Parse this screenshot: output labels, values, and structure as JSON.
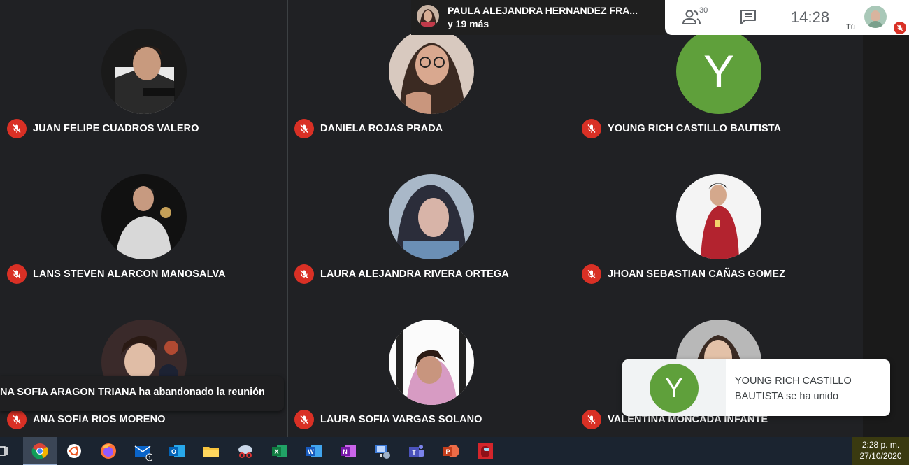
{
  "presenter": {
    "name": "PAULA ALEJANDRA HERNANDEZ FRA...",
    "more": "y 19 más"
  },
  "top_bar": {
    "participants_count": "30",
    "time": "14:28",
    "you_label": "Tú",
    "icons": [
      "people-icon",
      "chat-icon"
    ]
  },
  "participants": [
    {
      "name": "JUAN FELIPE CUADROS VALERO",
      "avatar": "photo"
    },
    {
      "name": "DANIELA ROJAS PRADA",
      "avatar": "photo"
    },
    {
      "name": "YOUNG RICH CASTILLO BAUTISTA",
      "avatar": "letter",
      "letter": "Y"
    },
    {
      "name": "LANS STEVEN ALARCON MANOSALVA",
      "avatar": "photo"
    },
    {
      "name": "LAURA ALEJANDRA RIVERA ORTEGA",
      "avatar": "photo"
    },
    {
      "name": "JHOAN SEBASTIAN CAÑAS GOMEZ",
      "avatar": "photo"
    },
    {
      "name": "ANA SOFIA RIOS MORENO",
      "avatar": "photo"
    },
    {
      "name": "LAURA SOFIA VARGAS SOLANO",
      "avatar": "photo"
    },
    {
      "name": "VALENTINA MONCADA INFANTE",
      "avatar": "photo"
    }
  ],
  "notifications": {
    "left_toast": "NA SOFIA ARAGON TRIANA ha abandonado la reunión",
    "right_toast": {
      "letter": "Y",
      "message": "YOUNG RICH CASTILLO BAUTISTA se ha unido"
    }
  },
  "taskbar": {
    "apps": [
      "task-view-icon",
      "chrome-icon",
      "ubuntu-icon",
      "firefox-icon",
      "mail-icon",
      "outlook-icon",
      "file-explorer-icon",
      "snipping-tool-icon",
      "excel-icon",
      "word-icon",
      "onenote-icon",
      "network-app-icon",
      "teams-icon",
      "powerpoint-icon",
      "among-us-icon"
    ],
    "mail_badge": "1",
    "clock_time": "2:28 p. m.",
    "clock_date": "27/10/2020"
  },
  "colors": {
    "meet_bg": "#202124",
    "mute_red": "#d93025",
    "avatar_green": "#5fa03b",
    "taskbar": "#1b2430"
  }
}
